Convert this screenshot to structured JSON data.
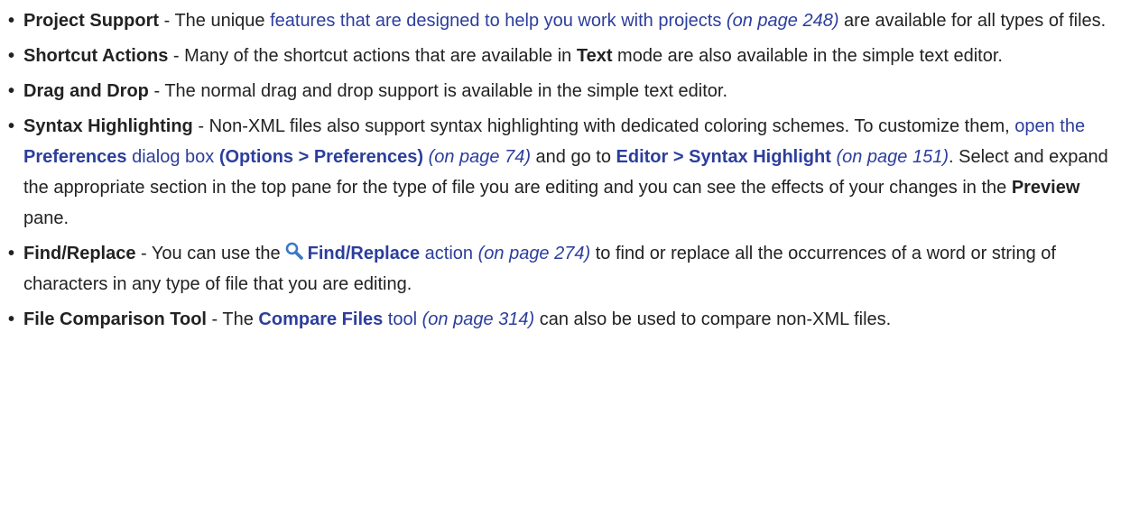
{
  "items": [
    {
      "term": "Project Support",
      "sep": " - ",
      "t1": "The unique ",
      "l1": "features that are designed to help you work with projects",
      "p1": " (on page 248)",
      "t2": " are available for all types of files."
    },
    {
      "term": "Shortcut Actions",
      "sep": " - ",
      "t1": "Many of the shortcut actions that are available in ",
      "b1": "Text",
      "t2": " mode are also available in the simple text editor."
    },
    {
      "term": "Drag and Drop",
      "sep": " - ",
      "t1": "The normal drag and drop support is available in the simple text editor."
    },
    {
      "term": "Syntax Highlighting",
      "sep": " - ",
      "t1": "Non-XML files also support syntax highlighting with dedicated coloring schemes. To customize them, ",
      "l1": "open the ",
      "l1b": "Preferences",
      "l1c": " dialog box ",
      "l1d": "(Options > Preferences)",
      "p1": " (on page 74)",
      "t2": " and go to ",
      "l2": "Editor > Syntax Highlight",
      "p2": " (on page 151)",
      "t3": ". Select and expand the appropriate section in the top pane for the type of file you are editing and you can see the effects of your changes in the ",
      "b1": "Preview",
      "t4": " pane."
    },
    {
      "term": "Find/Replace",
      "sep": " - ",
      "t1": "You can use the",
      "icon": "search-icon",
      "l1b": "Find/Replace",
      "l1c": " action",
      "p1": " (on page 274)",
      "t2": " to find or replace all the occurrences of a word or string of characters in any type of file that you are editing."
    },
    {
      "term": "File Comparison Tool",
      "sep": " - ",
      "t1": "The ",
      "l1b": "Compare Files",
      "l1c": " tool",
      "p1": " (on page 314)",
      "t2": " can also be used to compare non-XML files."
    }
  ],
  "colors": {
    "text": "#222222",
    "link": "#2c3e9c",
    "icon": "#3a77c8"
  }
}
